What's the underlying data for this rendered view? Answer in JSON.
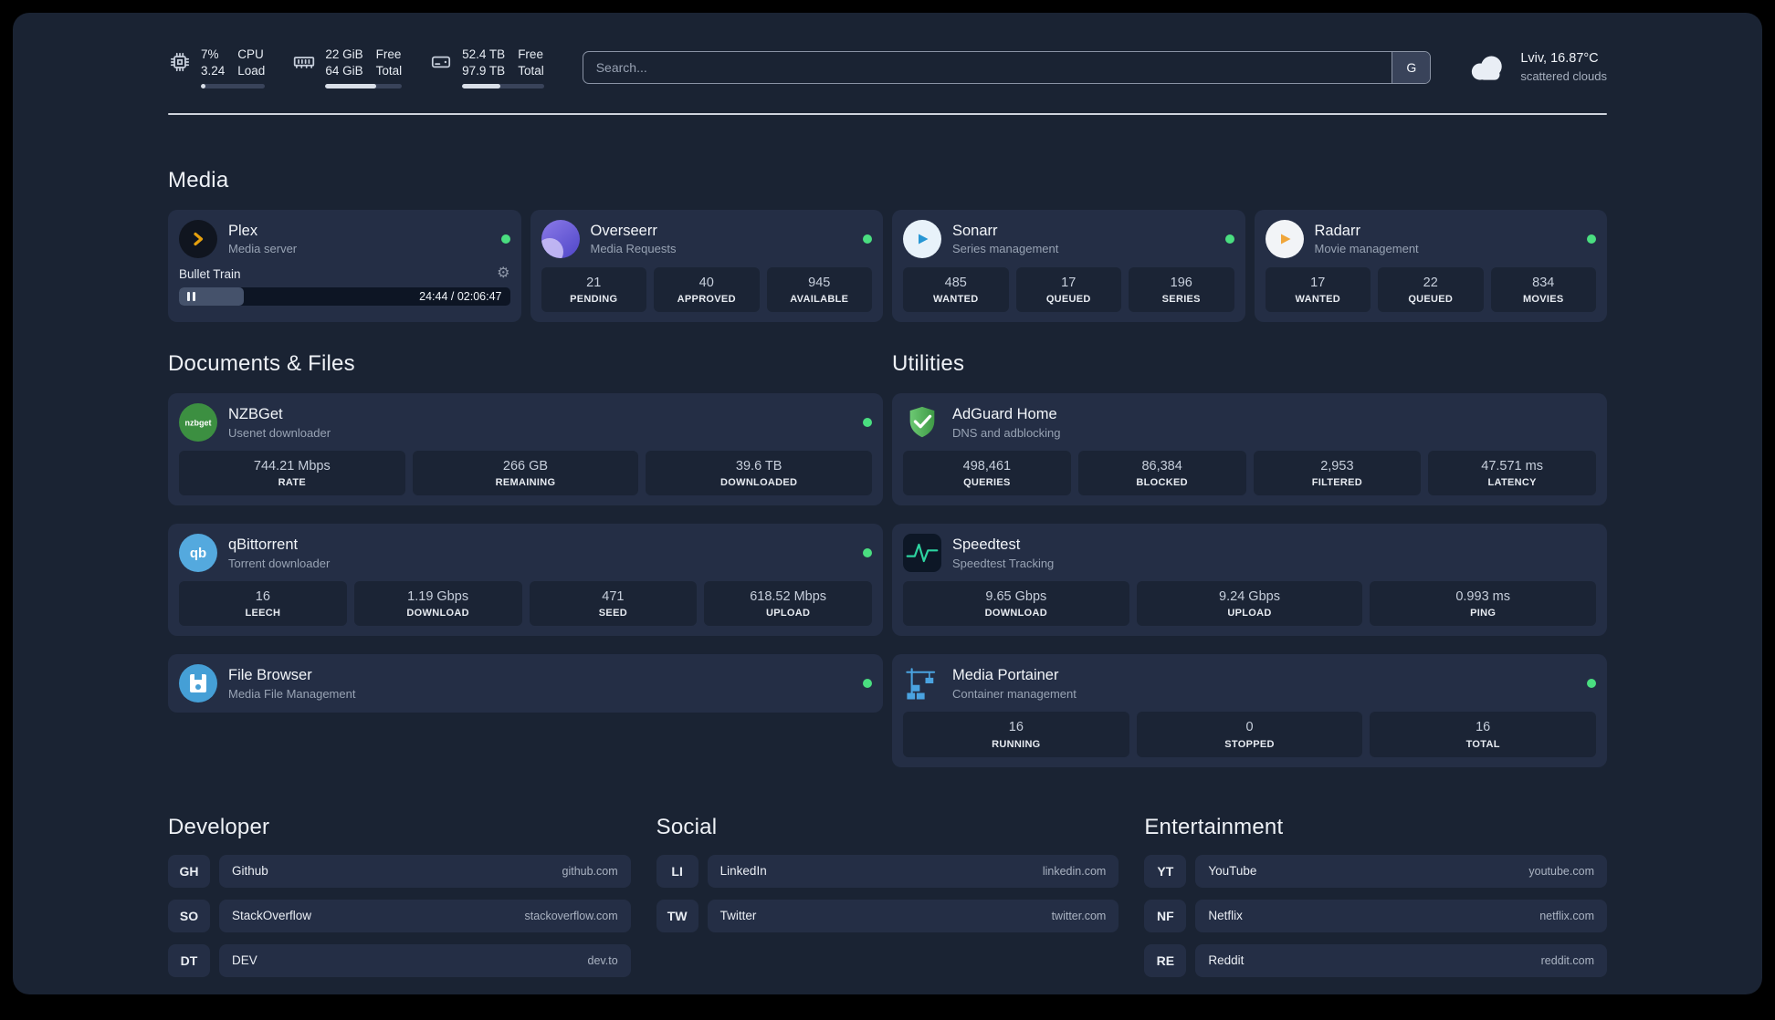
{
  "icons": {
    "gear": "⚙"
  },
  "header": {
    "cpu": {
      "v1": "7%",
      "v2": "3.24",
      "l1": "CPU",
      "l2": "Load",
      "bar": "7%"
    },
    "ram": {
      "v1": "22 GiB",
      "v2": "64 GiB",
      "l1": "Free",
      "l2": "Total",
      "bar": "66%"
    },
    "disk": {
      "v1": "52.4 TB",
      "v2": "97.9 TB",
      "l1": "Free",
      "l2": "Total",
      "bar": "47%"
    },
    "search": {
      "placeholder": "Search...",
      "engine": "G"
    },
    "weather": {
      "location": "Lviv, 16.87°C",
      "condition": "scattered clouds"
    }
  },
  "media": {
    "title": "Media",
    "plex": {
      "title": "Plex",
      "subtitle": "Media server",
      "track": "Bullet Train",
      "time": "24:44 / 02:06:47",
      "progress": "19.5%"
    },
    "overseerr": {
      "title": "Overseerr",
      "subtitle": "Media Requests",
      "stats": [
        {
          "v": "21",
          "l": "PENDING"
        },
        {
          "v": "40",
          "l": "APPROVED"
        },
        {
          "v": "945",
          "l": "AVAILABLE"
        }
      ]
    },
    "sonarr": {
      "title": "Sonarr",
      "subtitle": "Series management",
      "stats": [
        {
          "v": "485",
          "l": "WANTED"
        },
        {
          "v": "17",
          "l": "QUEUED"
        },
        {
          "v": "196",
          "l": "SERIES"
        }
      ]
    },
    "radarr": {
      "title": "Radarr",
      "subtitle": "Movie management",
      "stats": [
        {
          "v": "17",
          "l": "WANTED"
        },
        {
          "v": "22",
          "l": "QUEUED"
        },
        {
          "v": "834",
          "l": "MOVIES"
        }
      ]
    }
  },
  "documents": {
    "title": "Documents & Files",
    "nzbget": {
      "title": "NZBGet",
      "subtitle": "Usenet downloader",
      "stats": [
        {
          "v": "744.21 Mbps",
          "l": "RATE"
        },
        {
          "v": "266 GB",
          "l": "REMAINING"
        },
        {
          "v": "39.6 TB",
          "l": "DOWNLOADED"
        }
      ]
    },
    "qbittorrent": {
      "title": "qBittorrent",
      "subtitle": "Torrent downloader",
      "stats": [
        {
          "v": "16",
          "l": "LEECH"
        },
        {
          "v": "1.19 Gbps",
          "l": "DOWNLOAD"
        },
        {
          "v": "471",
          "l": "SEED"
        },
        {
          "v": "618.52 Mbps",
          "l": "UPLOAD"
        }
      ]
    },
    "filebrowser": {
      "title": "File Browser",
      "subtitle": "Media File Management"
    }
  },
  "utilities": {
    "title": "Utilities",
    "adguard": {
      "title": "AdGuard Home",
      "subtitle": "DNS and adblocking",
      "stats": [
        {
          "v": "498,461",
          "l": "QUERIES"
        },
        {
          "v": "86,384",
          "l": "BLOCKED"
        },
        {
          "v": "2,953",
          "l": "FILTERED"
        },
        {
          "v": "47.571 ms",
          "l": "LATENCY"
        }
      ]
    },
    "speedtest": {
      "title": "Speedtest",
      "subtitle": "Speedtest Tracking",
      "stats": [
        {
          "v": "9.65 Gbps",
          "l": "DOWNLOAD"
        },
        {
          "v": "9.24 Gbps",
          "l": "UPLOAD"
        },
        {
          "v": "0.993 ms",
          "l": "PING"
        }
      ]
    },
    "portainer": {
      "title": "Media Portainer",
      "subtitle": "Container management",
      "stats": [
        {
          "v": "16",
          "l": "RUNNING"
        },
        {
          "v": "0",
          "l": "STOPPED"
        },
        {
          "v": "16",
          "l": "TOTAL"
        }
      ]
    }
  },
  "bookmarks": {
    "developer": {
      "title": "Developer",
      "items": [
        {
          "abbr": "GH",
          "name": "Github",
          "url": "github.com"
        },
        {
          "abbr": "SO",
          "name": "StackOverflow",
          "url": "stackoverflow.com"
        },
        {
          "abbr": "DT",
          "name": "DEV",
          "url": "dev.to"
        }
      ]
    },
    "social": {
      "title": "Social",
      "items": [
        {
          "abbr": "LI",
          "name": "LinkedIn",
          "url": "linkedin.com"
        },
        {
          "abbr": "TW",
          "name": "Twitter",
          "url": "twitter.com"
        }
      ]
    },
    "entertainment": {
      "title": "Entertainment",
      "items": [
        {
          "abbr": "YT",
          "name": "YouTube",
          "url": "youtube.com"
        },
        {
          "abbr": "NF",
          "name": "Netflix",
          "url": "netflix.com"
        },
        {
          "abbr": "RE",
          "name": "Reddit",
          "url": "reddit.com"
        }
      ]
    }
  }
}
